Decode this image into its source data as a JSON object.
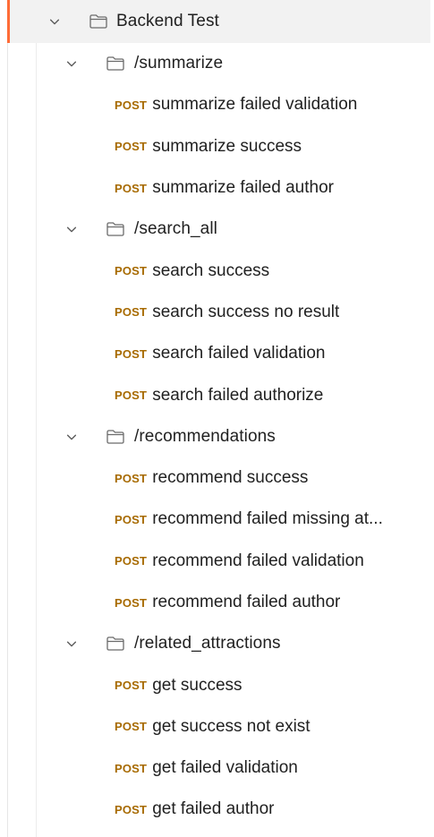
{
  "collection": {
    "name": "Backend Test",
    "chevron_icon": "chevron-down-icon",
    "folder_icon": "folder-icon",
    "accent_color": "#ff6c37"
  },
  "method_color": "#a76a00",
  "folders": [
    {
      "name": "/summarize",
      "requests": [
        {
          "method": "POST",
          "name": "summarize failed validation"
        },
        {
          "method": "POST",
          "name": "summarize success"
        },
        {
          "method": "POST",
          "name": "summarize failed author"
        }
      ]
    },
    {
      "name": "/search_all",
      "requests": [
        {
          "method": "POST",
          "name": "search success"
        },
        {
          "method": "POST",
          "name": "search success no result"
        },
        {
          "method": "POST",
          "name": "search failed validation"
        },
        {
          "method": "POST",
          "name": "search failed authorize"
        }
      ]
    },
    {
      "name": "/recommendations",
      "requests": [
        {
          "method": "POST",
          "name": "recommend success"
        },
        {
          "method": "POST",
          "name": "recommend failed missing at..."
        },
        {
          "method": "POST",
          "name": "recommend failed validation"
        },
        {
          "method": "POST",
          "name": "recommend failed author"
        }
      ]
    },
    {
      "name": "/related_attractions",
      "requests": [
        {
          "method": "POST",
          "name": "get success"
        },
        {
          "method": "POST",
          "name": "get success not exist"
        },
        {
          "method": "POST",
          "name": "get failed validation"
        },
        {
          "method": "POST",
          "name": "get failed author"
        }
      ]
    }
  ]
}
